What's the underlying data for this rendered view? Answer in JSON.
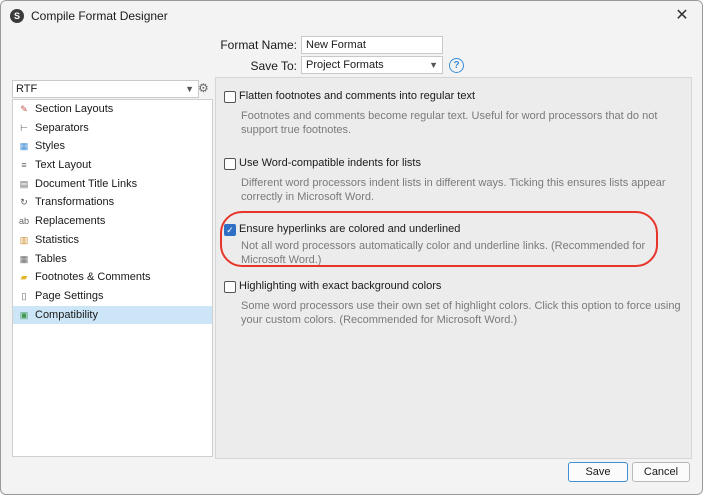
{
  "window": {
    "title": "Compile Format Designer"
  },
  "form": {
    "format_name_label": "Format Name:",
    "format_name_value": "New Format",
    "save_to_label": "Save To:",
    "save_to_value": "Project Formats"
  },
  "left": {
    "format_select": "RTF",
    "items": [
      {
        "label": "Section Layouts",
        "icon": "section-layouts-icon"
      },
      {
        "label": "Separators",
        "icon": "separators-icon"
      },
      {
        "label": "Styles",
        "icon": "styles-icon"
      },
      {
        "label": "Text Layout",
        "icon": "text-layout-icon"
      },
      {
        "label": "Document Title Links",
        "icon": "document-title-links-icon"
      },
      {
        "label": "Transformations",
        "icon": "transformations-icon"
      },
      {
        "label": "Replacements",
        "icon": "replacements-icon"
      },
      {
        "label": "Statistics",
        "icon": "statistics-icon"
      },
      {
        "label": "Tables",
        "icon": "tables-icon"
      },
      {
        "label": "Footnotes & Comments",
        "icon": "footnotes-comments-icon"
      },
      {
        "label": "Page Settings",
        "icon": "page-settings-icon"
      },
      {
        "label": "Compatibility",
        "icon": "compatibility-icon"
      }
    ],
    "selected_index": 11
  },
  "options": [
    {
      "label": "Flatten footnotes and comments into regular text",
      "checked": false,
      "desc": "Footnotes and comments become regular text. Useful for word processors that do not support true footnotes."
    },
    {
      "label": "Use Word-compatible indents for lists",
      "checked": false,
      "desc": "Different word processors indent lists in different ways. Ticking this ensures lists appear correctly in Microsoft Word."
    },
    {
      "label": "Ensure hyperlinks are colored and underlined",
      "checked": true,
      "desc": "Not all word processors automatically color and underline links. (Recommended for Microsoft Word.)"
    },
    {
      "label": "Highlighting with exact background colors",
      "checked": false,
      "desc": "Some word processors use their own set of highlight colors. Click this option to force using your custom colors. (Recommended for Microsoft Word.)"
    }
  ],
  "buttons": {
    "save": "Save",
    "cancel": "Cancel"
  },
  "colors": {
    "accent": "#2f6fc4",
    "highlight_ring": "#e8352a",
    "selection": "#cde6f7"
  }
}
